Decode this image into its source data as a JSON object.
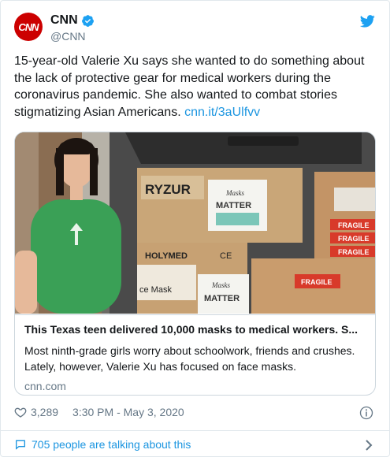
{
  "author": {
    "name": "CNN",
    "handle": "@CNN",
    "avatar_text": "CNN",
    "verified_icon": "verified-badge-icon",
    "platform_icon": "twitter-bird-icon"
  },
  "tweet": {
    "text": "15-year-old Valerie Xu says she wanted to do something about the lack of protective gear for medical workers during the coronavirus pandemic. She also wanted to combat stories stigmatizing Asian Americans. ",
    "link": "cnn.it/3aUlfvv"
  },
  "link_card": {
    "title": "This Texas teen delivered 10,000 masks to medical workers. S...",
    "description": "Most ninth-grade girls worry about schoolwork, friends and crushes. Lately, however, Valerie Xu has focused on face masks.",
    "domain": "cnn.com",
    "photo_texts": {
      "box1_brand": "RYZUR",
      "label_masks": "Masks",
      "label_matter": "MATTER",
      "fragile": "FRAGILE",
      "holymed": "HOLYMED",
      "mask_word": "ce Mask",
      "box2_masks": "Masks",
      "box2_matter": "MATTER",
      "ce": "CE"
    }
  },
  "footer": {
    "likes": "3,289",
    "timestamp": "3:30 PM - May 3, 2020",
    "talking": "705 people are talking about this"
  },
  "colors": {
    "accent": "#1b95e0",
    "cnn_red": "#cc0000",
    "muted": "#657786"
  }
}
